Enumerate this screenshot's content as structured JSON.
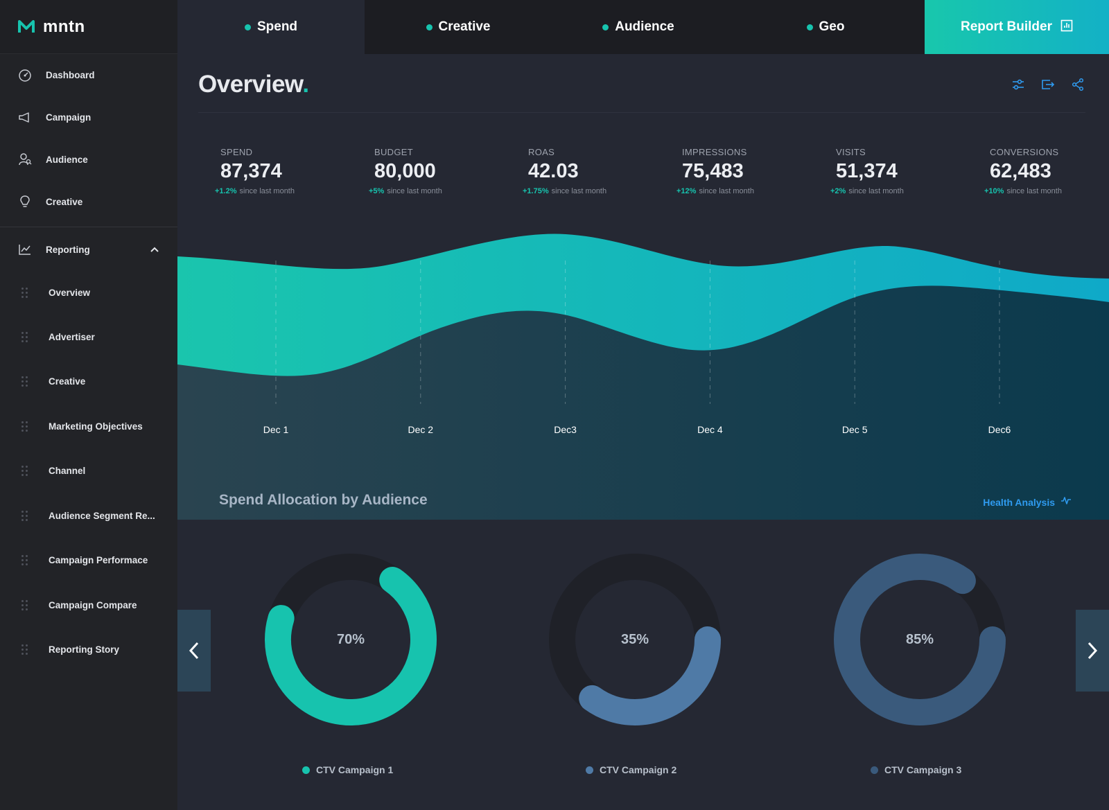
{
  "brand": {
    "name": "mntn",
    "accent": "#17c3ae"
  },
  "sidebar": {
    "items": [
      {
        "label": "Dashboard",
        "icon": "speedometer-icon"
      },
      {
        "label": "Campaign",
        "icon": "megaphone-icon"
      },
      {
        "label": "Audience",
        "icon": "user-search-icon"
      },
      {
        "label": "Creative",
        "icon": "lightbulb-icon"
      },
      {
        "label": "Reporting",
        "icon": "line-chart-icon",
        "expanded": true
      }
    ],
    "subitems": [
      {
        "label": "Overview"
      },
      {
        "label": "Advertiser"
      },
      {
        "label": "Creative"
      },
      {
        "label": "Marketing Objectives"
      },
      {
        "label": "Channel"
      },
      {
        "label": "Audience Segment Re..."
      },
      {
        "label": "Campaign Performace"
      },
      {
        "label": "Campaign Compare"
      },
      {
        "label": "Reporting Story"
      }
    ]
  },
  "tabs": [
    {
      "label": "Spend",
      "active": true
    },
    {
      "label": "Creative",
      "active": false
    },
    {
      "label": "Audience",
      "active": false
    },
    {
      "label": "Geo",
      "active": false
    }
  ],
  "report_builder": {
    "label": "Report Builder",
    "icon": "report-icon"
  },
  "overview": {
    "title": "Overview",
    "title_mark": ".",
    "actions": [
      "filter-sliders-icon",
      "export-icon",
      "share-icon"
    ]
  },
  "kpis": [
    {
      "label": "SPEND",
      "value": "87,374",
      "delta": "+1.2%",
      "note": "since last month"
    },
    {
      "label": "BUDGET",
      "value": "80,000",
      "delta": "+5%",
      "note": "since last month"
    },
    {
      "label": "ROAS",
      "value": "42.03",
      "delta": "+1.75%",
      "note": "since last month"
    },
    {
      "label": "IMPRESSIONS",
      "value": "75,483",
      "delta": "+12%",
      "note": "since last month"
    },
    {
      "label": "VISITS",
      "value": "51,374",
      "delta": "+2%",
      "note": "since last month"
    },
    {
      "label": "CONVERSIONS",
      "value": "62,483",
      "delta": "+10%",
      "note": "since last month"
    }
  ],
  "chart_data": [
    {
      "type": "area",
      "x": [
        "Dec 1",
        "Dec 2",
        "Dec3",
        "Dec 4",
        "Dec 5",
        "Dec6"
      ],
      "grid": true,
      "colors": [
        "#1ac5ad",
        "#0fa9c8",
        "#234556"
      ]
    },
    {
      "type": "pie",
      "title": "Spend Allocation by Audience",
      "series": [
        {
          "name": "CTV Campaign 1",
          "value": 70,
          "label": "70%",
          "color": "#17c3ae"
        },
        {
          "name": "CTV Campaign 2",
          "value": 35,
          "label": "35%",
          "color": "#4f7aa6"
        },
        {
          "name": "CTV Campaign 3",
          "value": 85,
          "label": "85%",
          "color": "#3a5a7c"
        }
      ]
    }
  ],
  "health_analysis": {
    "label": "Health Analysis",
    "icon": "pulse-icon"
  }
}
